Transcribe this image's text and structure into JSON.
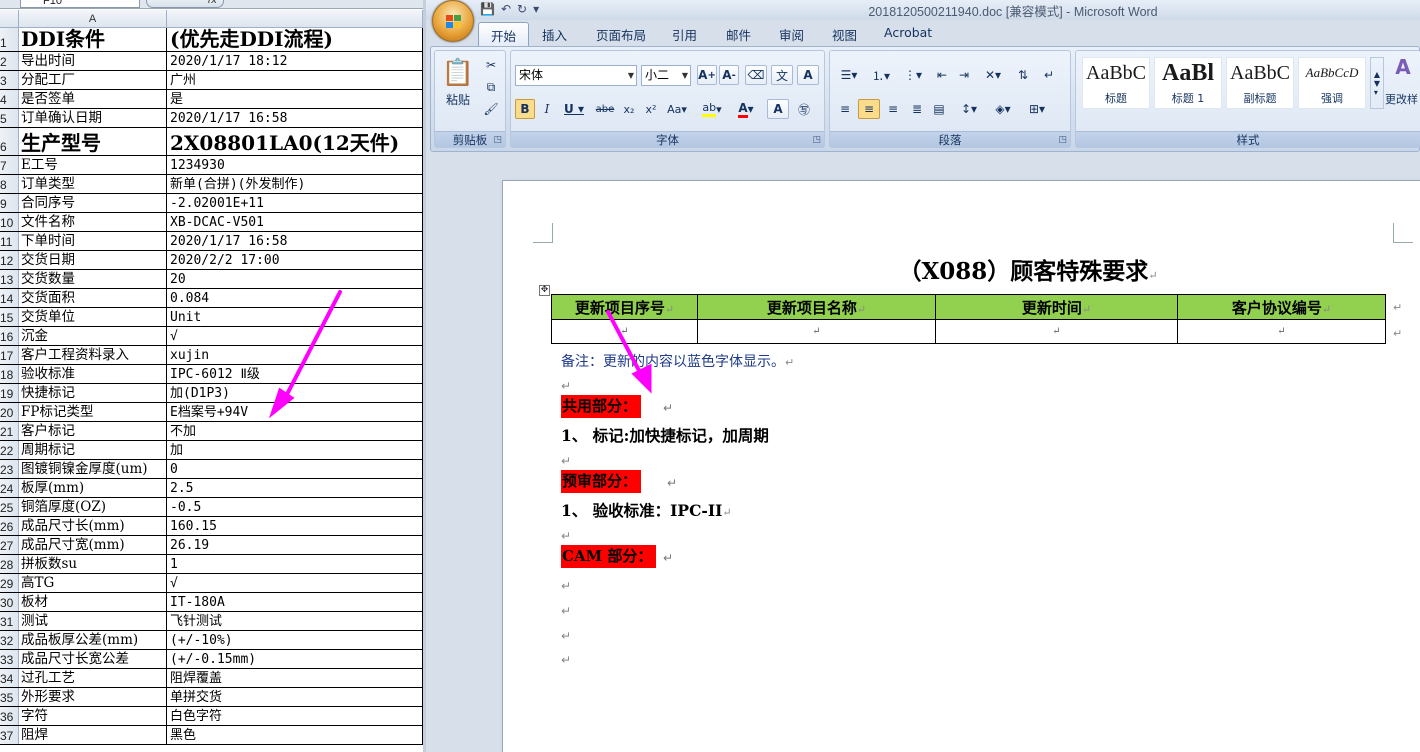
{
  "excel": {
    "name_box": "F10",
    "fx_label": "fx",
    "column_header": "A",
    "rows": [
      {
        "n": "1",
        "a": "DDI条件",
        "b": "(优先走DDI流程)",
        "big": true
      },
      {
        "n": "2",
        "a": "导出时间",
        "b": "2020/1/17 18:12"
      },
      {
        "n": "3",
        "a": "分配工厂",
        "b": "广州"
      },
      {
        "n": "4",
        "a": "是否签单",
        "b": "是"
      },
      {
        "n": "5",
        "a": "订单确认日期",
        "b": "2020/1/17 16:58"
      },
      {
        "n": "6",
        "a": "生产型号",
        "b": "2X08801LA0(12天件)",
        "big": true
      },
      {
        "n": "7",
        "a": "E工号",
        "b": "1234930"
      },
      {
        "n": "8",
        "a": "订单类型",
        "b": "新单(合拼)(外发制作)"
      },
      {
        "n": "9",
        "a": "合同序号",
        "b": "-2.02001E+11"
      },
      {
        "n": "10",
        "a": "文件名称",
        "b": "XB-DCAC-V501"
      },
      {
        "n": "11",
        "a": "下单时间",
        "b": "2020/1/17 16:58"
      },
      {
        "n": "12",
        "a": "交货日期",
        "b": "2020/2/2 17:00"
      },
      {
        "n": "13",
        "a": "交货数量",
        "b": "20"
      },
      {
        "n": "14",
        "a": "交货面积",
        "b": "0.084"
      },
      {
        "n": "15",
        "a": "交货单位",
        "b": "Unit"
      },
      {
        "n": "16",
        "a": "沉金",
        "b": "√"
      },
      {
        "n": "17",
        "a": "客户工程资料录入",
        "b": "xujin"
      },
      {
        "n": "18",
        "a": "验收标准",
        "b": "IPC-6012 Ⅱ级"
      },
      {
        "n": "19",
        "a": "快捷标记",
        "b": "加(D1P3)"
      },
      {
        "n": "20",
        "a": "FP标记类型",
        "b": "E档案号+94V"
      },
      {
        "n": "21",
        "a": "客户标记",
        "b": "不加"
      },
      {
        "n": "22",
        "a": "周期标记",
        "b": "加"
      },
      {
        "n": "23",
        "a": "图镀铜镍金厚度(um)",
        "b": "0"
      },
      {
        "n": "24",
        "a": "板厚(mm)",
        "b": "2.5"
      },
      {
        "n": "25",
        "a": "铜箔厚度(OZ)",
        "b": "-0.5"
      },
      {
        "n": "26",
        "a": "成品尺寸长(mm)",
        "b": "160.15"
      },
      {
        "n": "27",
        "a": "成品尺寸宽(mm)",
        "b": "26.19"
      },
      {
        "n": "28",
        "a": "拼板数su",
        "b": "1"
      },
      {
        "n": "29",
        "a": "高TG",
        "b": "√"
      },
      {
        "n": "30",
        "a": "板材",
        "b": "IT-180A"
      },
      {
        "n": "31",
        "a": "测试",
        "b": "飞针测试"
      },
      {
        "n": "32",
        "a": "成品板厚公差(mm)",
        "b": "(+/-10%)"
      },
      {
        "n": "33",
        "a": "成品尺寸长宽公差",
        "b": "(+/-0.15mm)"
      },
      {
        "n": "34",
        "a": "过孔工艺",
        "b": "阻焊覆盖"
      },
      {
        "n": "35",
        "a": "外形要求",
        "b": "单拼交货"
      },
      {
        "n": "36",
        "a": "字符",
        "b": "白色字符"
      },
      {
        "n": "37",
        "a": "阻焊",
        "b": "黑色"
      }
    ]
  },
  "word": {
    "window_title": "2018120500211940.doc [兼容模式] - Microsoft Word",
    "tabs": [
      "开始",
      "插入",
      "页面布局",
      "引用",
      "邮件",
      "审阅",
      "视图",
      "Acrobat"
    ],
    "ribbon": {
      "clipboard_label": "剪贴板",
      "paste_label": "粘贴",
      "font_group_label": "字体",
      "font_name": "宋体",
      "font_size": "小二",
      "paragraph_label": "段落",
      "styles_label": "样式",
      "styles": [
        {
          "sample": "AaBbC",
          "name": "标题"
        },
        {
          "sample": "AaBl",
          "name": "标题 1"
        },
        {
          "sample": "AaBbC",
          "name": "副标题"
        },
        {
          "sample": "AaBbCcD",
          "name": "强调"
        }
      ],
      "change_styles_label": "更改样"
    },
    "document": {
      "title": "（X088）顾客特殊要求",
      "table_headers": [
        "更新项目序号",
        "更新项目名称",
        "更新时间",
        "客户协议编号"
      ],
      "note": "备注：更新的内容以蓝色字体显示。",
      "sections": [
        {
          "heading": "共用部分：",
          "items": [
            "1、 标记:加快捷标记，加周期"
          ]
        },
        {
          "heading": "预审部分：",
          "items": [
            "1、 验收标准：IPC-II"
          ]
        },
        {
          "heading": "CAM 部分：",
          "items": []
        }
      ]
    }
  },
  "colors": {
    "arrow": "#ff00ff",
    "table_header_fill": "#92d050",
    "section_highlight": "#ff0000",
    "note_text": "#1f3a8a"
  }
}
